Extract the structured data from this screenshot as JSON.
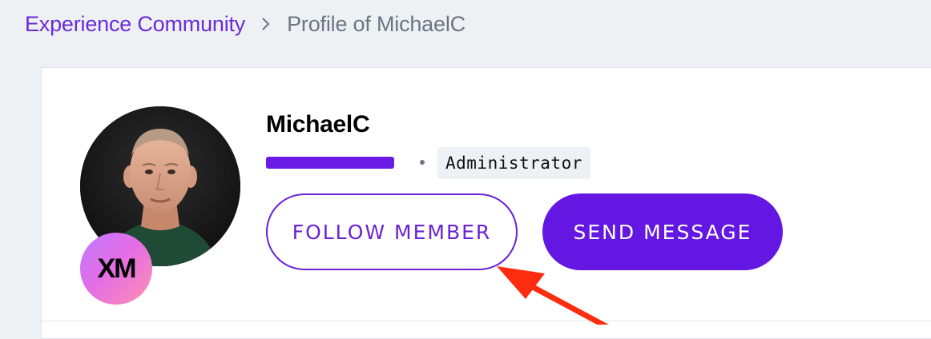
{
  "breadcrumb": {
    "root_label": "Experience Community",
    "separator_icon": "chevron-right-icon",
    "current_label": "Profile of MichaelC"
  },
  "profile": {
    "name": "MichaelC",
    "role": "Administrator",
    "badge_label": "XM",
    "redacted_field_color": "#6a1be6"
  },
  "actions": {
    "follow_label": "FOLLOW MEMBER",
    "message_label": "SEND MESSAGE"
  },
  "annotation": {
    "icon": "red-arrow-icon",
    "color": "#ff2d0f"
  },
  "colors": {
    "accent": "#6417e2",
    "background": "#eef1f4",
    "card": "#ffffff"
  }
}
